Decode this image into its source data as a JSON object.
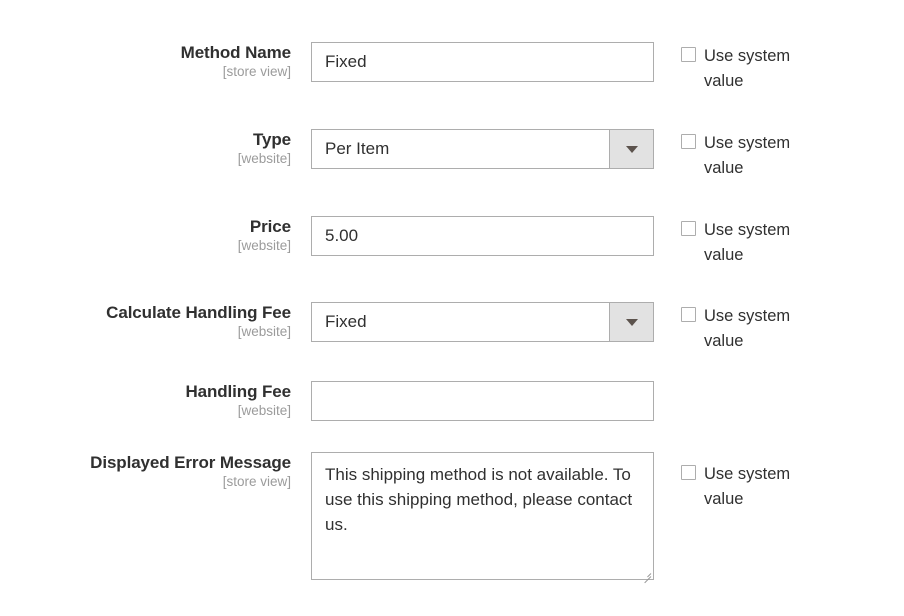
{
  "form": {
    "system_value_label": "Use system value",
    "fields": [
      {
        "id": "method-name",
        "label": "Method Name",
        "scope": "[store view]",
        "control": "text",
        "value": "Fixed",
        "placeholder": "",
        "has_system_value": true
      },
      {
        "id": "type",
        "label": "Type",
        "scope": "[website]",
        "control": "select",
        "value": "Per Item",
        "has_system_value": true
      },
      {
        "id": "price",
        "label": "Price",
        "scope": "[website]",
        "control": "text",
        "value": "5.00",
        "placeholder": "",
        "has_system_value": true
      },
      {
        "id": "calculate-handling-fee",
        "label": "Calculate Handling Fee",
        "scope": "[website]",
        "control": "select",
        "value": "Fixed",
        "has_system_value": true
      },
      {
        "id": "handling-fee",
        "label": "Handling Fee",
        "scope": "[website]",
        "control": "text",
        "value": "",
        "placeholder": "",
        "has_system_value": false
      },
      {
        "id": "displayed-error-message",
        "label": "Displayed Error Message",
        "scope": "[store view]",
        "control": "textarea",
        "value": "This shipping method is not available. To use this shipping method, please contact us.",
        "has_system_value": true
      }
    ]
  },
  "colors": {
    "label_text": "#303030",
    "scope_text": "#9b9b9b",
    "input_border": "#adadad",
    "select_button_bg": "#e2e2e2",
    "select_arrow": "#5c534d",
    "page_bg": "#ffffff"
  }
}
